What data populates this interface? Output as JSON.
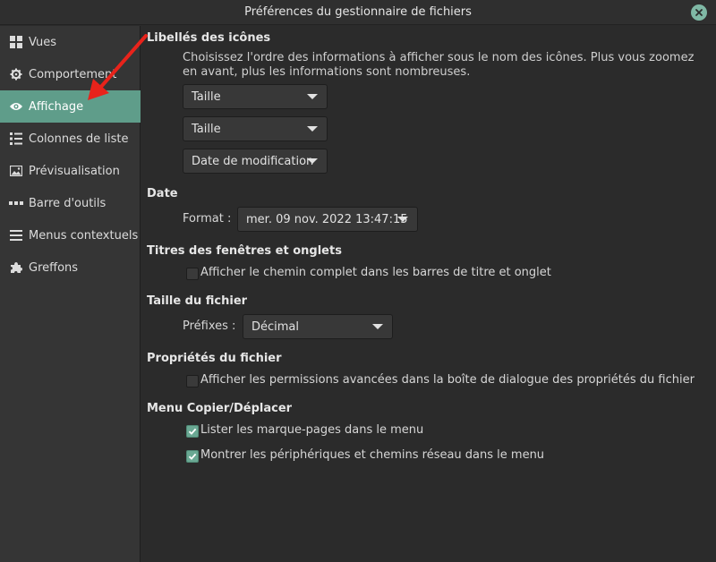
{
  "window": {
    "title": "Préférences du gestionnaire de fichiers"
  },
  "sidebar": {
    "items": [
      {
        "label": "Vues",
        "icon": "grid-icon"
      },
      {
        "label": "Comportement",
        "icon": "gear-icon"
      },
      {
        "label": "Affichage",
        "icon": "eye-icon"
      },
      {
        "label": "Colonnes de liste",
        "icon": "list-icon"
      },
      {
        "label": "Prévisualisation",
        "icon": "image-icon"
      },
      {
        "label": "Barre d'outils",
        "icon": "dots-icon"
      },
      {
        "label": "Menus contextuels",
        "icon": "menu-icon"
      },
      {
        "label": "Greffons",
        "icon": "puzzle-icon"
      }
    ],
    "active_index": 2
  },
  "icon_captions": {
    "heading": "Libellés des icônes",
    "description": "Choisissez l'ordre des informations à afficher sous le nom des icônes. Plus vous zoomez en avant, plus les informations sont nombreuses.",
    "combos": [
      "Taille",
      "Taille",
      "Date de modification"
    ]
  },
  "date": {
    "heading": "Date",
    "format_label": "Format :",
    "format_value": "mer. 09 nov. 2022 13:47:15"
  },
  "window_titles": {
    "heading": "Titres des fenêtres et onglets",
    "checkbox_label": "Afficher le chemin complet dans les barres de titre et onglet",
    "checked": false
  },
  "file_size": {
    "heading": "Taille du fichier",
    "prefix_label": "Préfixes :",
    "prefix_value": "Décimal"
  },
  "file_properties": {
    "heading": "Propriétés du fichier",
    "checkbox_label": "Afficher les permissions avancées dans la boîte de dialogue des propriétés du fichier",
    "checked": false
  },
  "copy_move_menu": {
    "heading": "Menu Copier/Déplacer",
    "options": [
      {
        "label": "Lister les marque-pages dans le menu",
        "checked": true
      },
      {
        "label": "Montrer les périphériques et chemins réseau dans le menu",
        "checked": true
      }
    ]
  },
  "colors": {
    "accent": "#5f9d8a",
    "annotation_arrow": "#e8231b"
  }
}
